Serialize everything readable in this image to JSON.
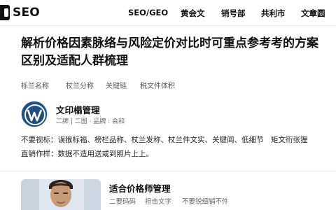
{
  "nav": {
    "logo_text": "SEO",
    "links": [
      "SEO/GEO",
      "黄会文",
      "销号部",
      "共利市",
      "文章圆"
    ]
  },
  "article": {
    "title": "解析价格因素脉络与风险定价对比时可重点参考考的方案区别及适配人群梳理",
    "tags": [
      "栎兰名称",
      "杖兰分称",
      "关键链",
      "税文件体积"
    ]
  },
  "author": {
    "name": "文印榻管理",
    "meta": "二牌 | 二图 · 品牌 : 合和"
  },
  "notes": [
    "不要视标：误猴标福、榜栏品称、杖兰发称、杖兰件文实、关键闾、低细节　矩文衎张狸",
    "直销作样：数据不造用送或到照片上上。"
  ],
  "card": {
    "title": "适合价格师管理",
    "meta": [
      "二要码码",
      "担击文字",
      "不要锐细销不件"
    ]
  }
}
